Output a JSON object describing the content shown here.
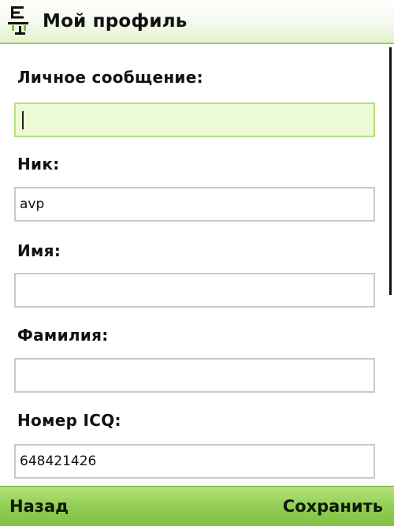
{
  "header": {
    "title": "Мой профиль",
    "icon": "app-logo-icon"
  },
  "form": {
    "fields": [
      {
        "label": "Личное сообщение:",
        "value": "",
        "focused": true
      },
      {
        "label": "Ник:",
        "value": "avp"
      },
      {
        "label": "Имя:",
        "value": ""
      },
      {
        "label": "Фамилия:",
        "value": ""
      },
      {
        "label": "Номер ICQ:",
        "value": "648421426"
      }
    ]
  },
  "softkeys": {
    "left_label": "Назад",
    "right_label": "Сохранить"
  },
  "colors": {
    "accent": "#8fcd52",
    "focus_field": "#ecfbd3"
  }
}
